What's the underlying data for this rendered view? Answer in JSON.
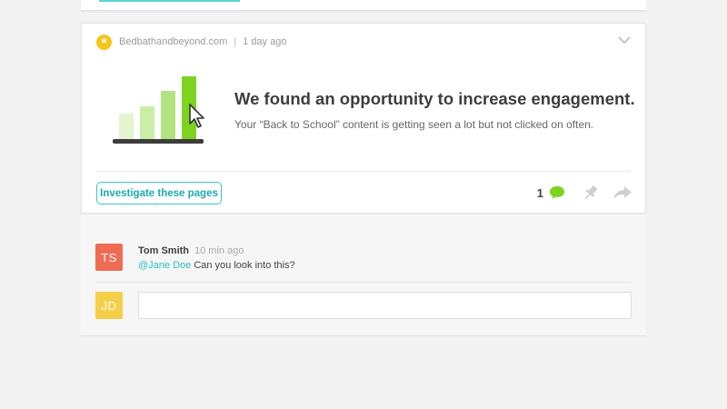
{
  "card": {
    "source": "Bedbathandbeyond.com",
    "separator": "|",
    "time": "1 day ago",
    "headline": "We found an opportunity to increase engagement.",
    "description": "Your “Back to School” content is getting seen a lot but not clicked on often.",
    "action_button": "Investigate these pages",
    "comment_count": "1"
  },
  "comments": {
    "items": [
      {
        "initials": "TS",
        "author": "Tom Smith",
        "time": "10 min ago",
        "mention": "@Jane Doe",
        "text": " Can you look into this?"
      }
    ],
    "reply": {
      "initials": "JD",
      "placeholder": ""
    }
  },
  "colors": {
    "accent": "#39c5c9",
    "star": "#f5c518",
    "avatar_ts": "#ef6b53",
    "avatar_jd": "#f5cf47",
    "chart_green": "#7ed321"
  },
  "icons": [
    "star-icon",
    "chevron-down-icon",
    "bar-chart-illustration",
    "cursor-icon",
    "comment-bubble-icon",
    "pin-icon",
    "share-icon"
  ]
}
